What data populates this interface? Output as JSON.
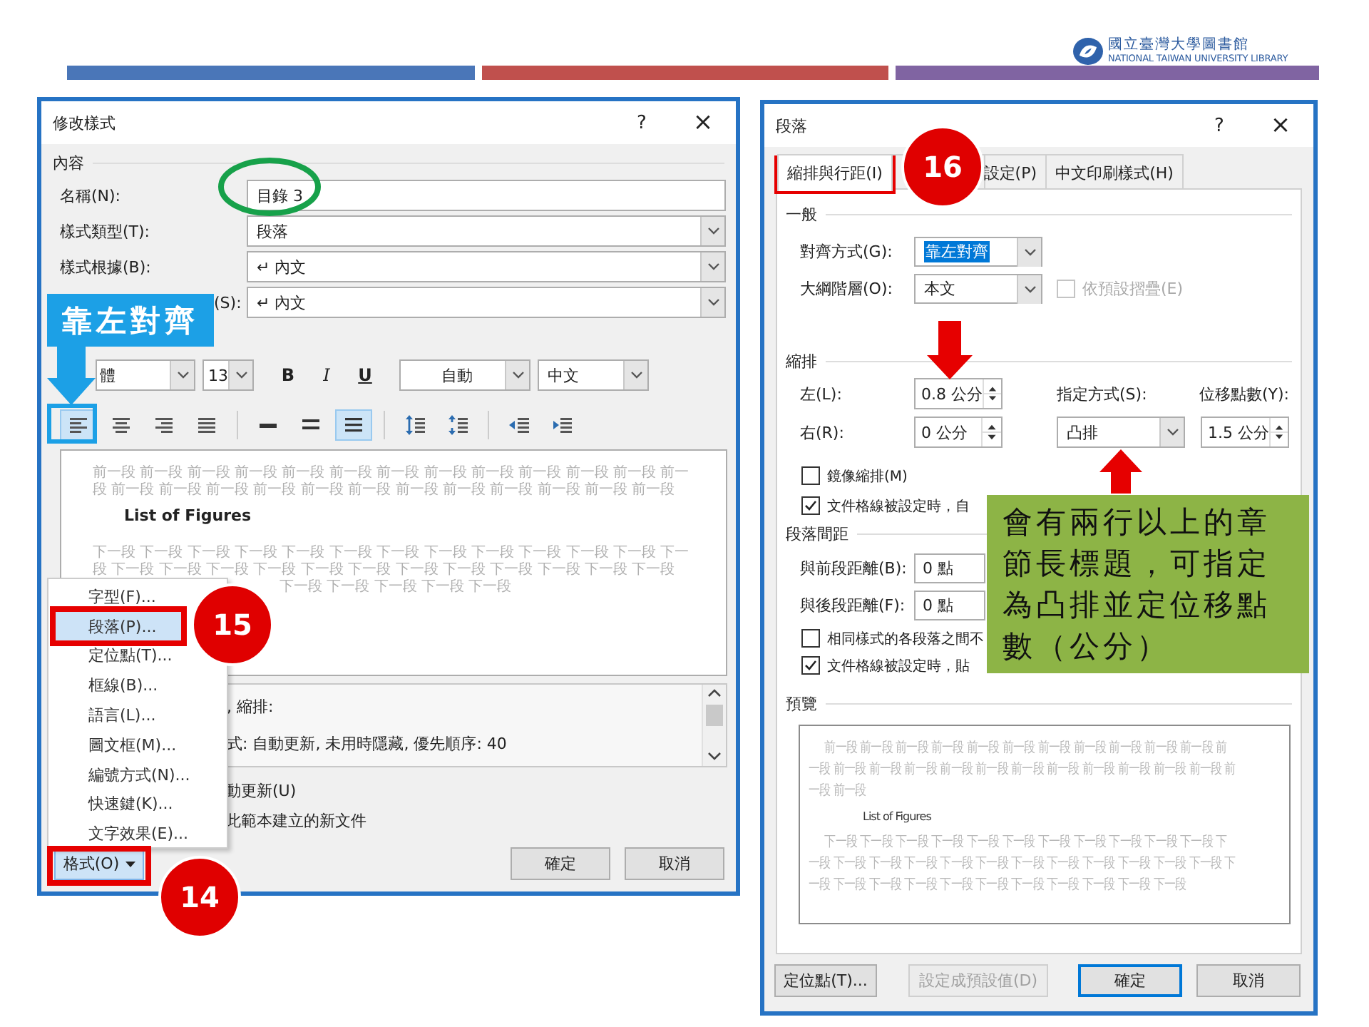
{
  "header": {
    "logo_title": "國立臺灣大學圖書館",
    "logo_subtitle": "NATIONAL TAIWAN UNIVERSITY LIBRARY",
    "bars": [
      {
        "color": "#4a76b8"
      },
      {
        "color": "#c0504d"
      },
      {
        "color": "#8064a2"
      }
    ]
  },
  "modify_style_dialog": {
    "title": "修改樣式",
    "help": "?",
    "close": "×",
    "group_label": "內容",
    "fields": [
      {
        "label": "名稱(N):",
        "value": "目錄 3",
        "kind": "text"
      },
      {
        "label": "樣式類型(T):",
        "value": "段落",
        "kind": "dropdown"
      },
      {
        "label": "樣式根據(B):",
        "value": "↵ 內文",
        "kind": "dropdown"
      },
      {
        "label": "(S):",
        "value": "↵ 內文",
        "kind": "dropdown"
      }
    ],
    "format_bar": {
      "font": "體",
      "size": "13",
      "bold": "B",
      "italic": "I",
      "underline": "U",
      "font_color": "自動",
      "language": "中文"
    },
    "toolbar_groups": [
      {
        "buttons": [
          {
            "kind": "align-left",
            "selected": true
          },
          {
            "kind": "align-center",
            "selected": false
          },
          {
            "kind": "align-right",
            "selected": false
          },
          {
            "kind": "justify",
            "selected": false
          }
        ]
      },
      {
        "buttons": [
          {
            "kind": "spacing-single",
            "selected": false
          },
          {
            "kind": "spacing-onehalf",
            "selected": false
          },
          {
            "kind": "spacing-double",
            "selected": true
          }
        ]
      },
      {
        "buttons": [
          {
            "kind": "space-up",
            "selected": false
          },
          {
            "kind": "space-down",
            "selected": false
          }
        ]
      },
      {
        "buttons": [
          {
            "kind": "indent-decrease",
            "selected": false
          },
          {
            "kind": "indent-increase",
            "selected": false
          }
        ]
      }
    ],
    "preview": {
      "before": [
        "前一段 前一段 前一段 前一段 前一段 前一段 前一段 前一段 前一段 前一段 前一段 前一段 前一",
        "段 前一段 前一段 前一段 前一段 前一段 前一段 前一段 前一段 前一段 前一段 前一段 前一段"
      ],
      "sample": "List of Figures",
      "after": [
        "下一段 下一段 下一段 下一段 下一段 下一段 下一段 下一段 下一段 下一段 下一段 下一段 下一",
        "段 下一段 下一段 下一段 下一段 下一段 下一段 下一段 下一段 下一段 下一段 下一段 下一段"
      ],
      "after_partial": "下一段 下一段 下一段 下一段 下一段"
    },
    "description": [
      ", 縮排:",
      "式: 自動更新, 未用時隱藏, 優先順序: 40"
    ],
    "options": [
      "動更新(U)",
      "此範本建立的新文件"
    ],
    "format_button": "格式(O)",
    "buttons": [
      "確定",
      "取消"
    ],
    "format_menu": {
      "items": [
        {
          "label": "字型(F)...",
          "selected": false
        },
        {
          "label": "段落(P)...",
          "selected": true
        },
        {
          "label": "定位點(T)...",
          "selected": false
        },
        {
          "label": "框線(B)...",
          "selected": false
        },
        {
          "label": "語言(L)...",
          "selected": false
        },
        {
          "label": "圖文框(M)...",
          "selected": false
        },
        {
          "label": "編號方式(N)...",
          "selected": false
        },
        {
          "label": "快速鍵(K)...",
          "selected": false
        },
        {
          "label": "文字效果(E)...",
          "selected": false
        }
      ]
    }
  },
  "paragraph_dialog": {
    "title": "段落",
    "help": "?",
    "close": "×",
    "tabs": [
      {
        "label": "縮排與行距(I)",
        "selected": true
      },
      {
        "label": "設定(P)",
        "selected": false
      },
      {
        "label": "中文印刷樣式(H)",
        "selected": false
      }
    ],
    "general": {
      "legend": "一般",
      "alignment": {
        "label": "對齊方式(G):",
        "value": "靠左對齊"
      },
      "outline": {
        "label": "大綱階層(O):",
        "value": "本文"
      },
      "collapse": {
        "label": "依預設摺疊(E)",
        "checked": false,
        "disabled": true
      }
    },
    "indent": {
      "legend": "縮排",
      "left": {
        "label": "左(L):",
        "value": "0.8 公分"
      },
      "right": {
        "label": "右(R):",
        "value": "0 公分"
      },
      "special": {
        "label": "指定方式(S):",
        "value": "凸排"
      },
      "by": {
        "label": "位移點數(Y):",
        "value": "1.5 公分"
      },
      "options": [
        {
          "label": "鏡像縮排(M)",
          "checked": false
        },
        {
          "label": "文件格線被設定時，自",
          "checked": true
        }
      ]
    },
    "spacing": {
      "legend": "段落間距",
      "before": {
        "label": "與前段距離(B):",
        "value": "0 點"
      },
      "after": {
        "label": "與後段距離(F):",
        "value": "0 點"
      },
      "options": [
        {
          "label": "相同樣式的各段落之間不",
          "checked": false
        },
        {
          "label": "文件格線被設定時，貼",
          "checked": true
        }
      ]
    },
    "preview": {
      "legend": "預覽",
      "before": [
        "前一段 前一段 前一段 前一段 前一段 前一段 前一段 前一段 前一段 前一段 前一段 前",
        "一段 前一段 前一段 前一段 前一段 前一段 前一段 前一段 前一段 前一段 前一段 前一段 前",
        "一段 前一段"
      ],
      "sample": "List of Figures",
      "after": [
        "下一段 下一段 下一段 下一段 下一段 下一段 下一段 下一段 下一段 下一段 下一段 下",
        "一段 下一段 下一段 下一段 下一段 下一段 下一段 下一段 下一段 下一段 下一段 下一段 下",
        "一段 下一段 下一段 下一段 下一段 下一段 下一段 下一段 下一段 下一段 下一段"
      ]
    },
    "buttons": [
      {
        "label": "定位點(T)...",
        "disabled": false,
        "default": false
      },
      {
        "label": "設定成預設值(D)",
        "disabled": true,
        "default": false
      },
      {
        "label": "確定",
        "disabled": false,
        "default": true
      },
      {
        "label": "取消",
        "disabled": false,
        "default": false
      }
    ]
  },
  "annotations": {
    "steps": [
      {
        "label": "15"
      },
      {
        "label": "14"
      },
      {
        "label": "16"
      }
    ],
    "callouts": [
      {
        "text": "靠左對齊"
      },
      {
        "text": "會有兩行以上的章節長標題，可指定為凸排並定位移點數（公分）"
      }
    ]
  }
}
